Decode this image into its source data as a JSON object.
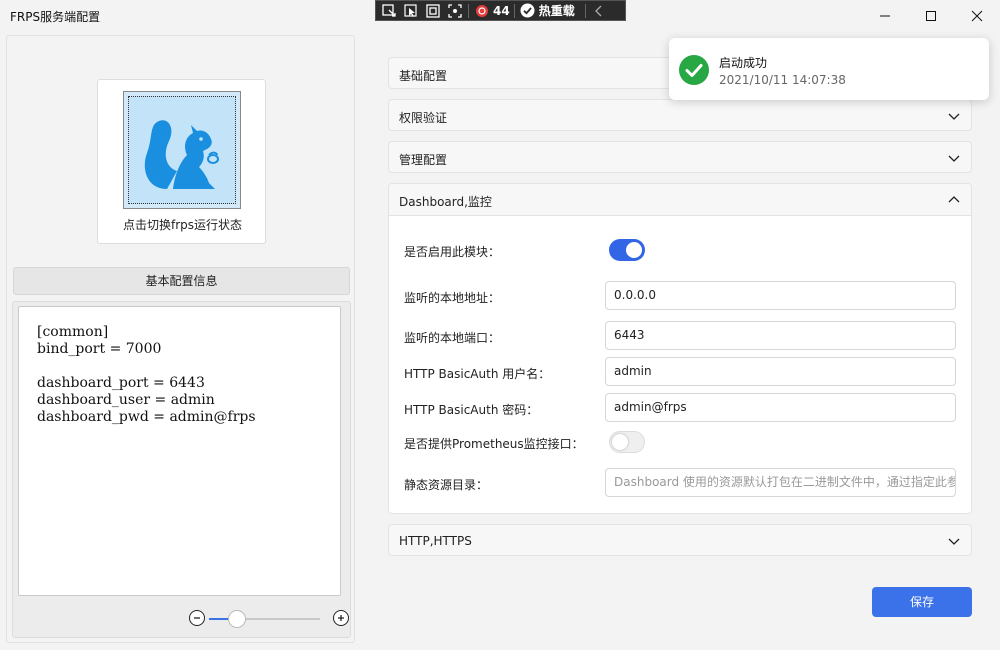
{
  "window": {
    "title": "FRPS服务端配置"
  },
  "debug_toolbar": {
    "fps": "44",
    "hot_reload_label": "热重载"
  },
  "left": {
    "logo_caption": "点击切换frps运行状态",
    "section_button": "基本配置信息",
    "config_text": "[common]\nbind_port = 7000\n\ndashboard_port = 6443\ndashboard_user = admin\ndashboard_pwd = admin@frps",
    "zoom_level": 0.25
  },
  "accordion": {
    "basic": "基础配置",
    "auth": "权限验证",
    "manage": "管理配置",
    "dashboard": "Dashboard,监控",
    "http": "HTTP,HTTPS"
  },
  "dashboard_form": {
    "enable_label": "是否启用此模块：",
    "enable_value": true,
    "addr_label": "监听的本地地址：",
    "addr_value": "0.0.0.0",
    "port_label": "监听的本地端口：",
    "port_value": "6443",
    "user_label": "HTTP BasicAuth 用户名：",
    "user_value": "admin",
    "pwd_label": "HTTP BasicAuth 密码：",
    "pwd_value": "admin@frps",
    "prom_label": "是否提供Prometheus监控接口：",
    "prom_value": false,
    "static_label": "静态资源目录：",
    "static_placeholder": "Dashboard 使用的资源默认打包在二进制文件中，通过指定此参"
  },
  "save_label": "保存",
  "toast": {
    "title": "启动成功",
    "time": "2021/10/11 14:07:38"
  },
  "colors": {
    "accent": "#3b72ea",
    "success": "#28a745",
    "logo": "#1a8fe0"
  }
}
